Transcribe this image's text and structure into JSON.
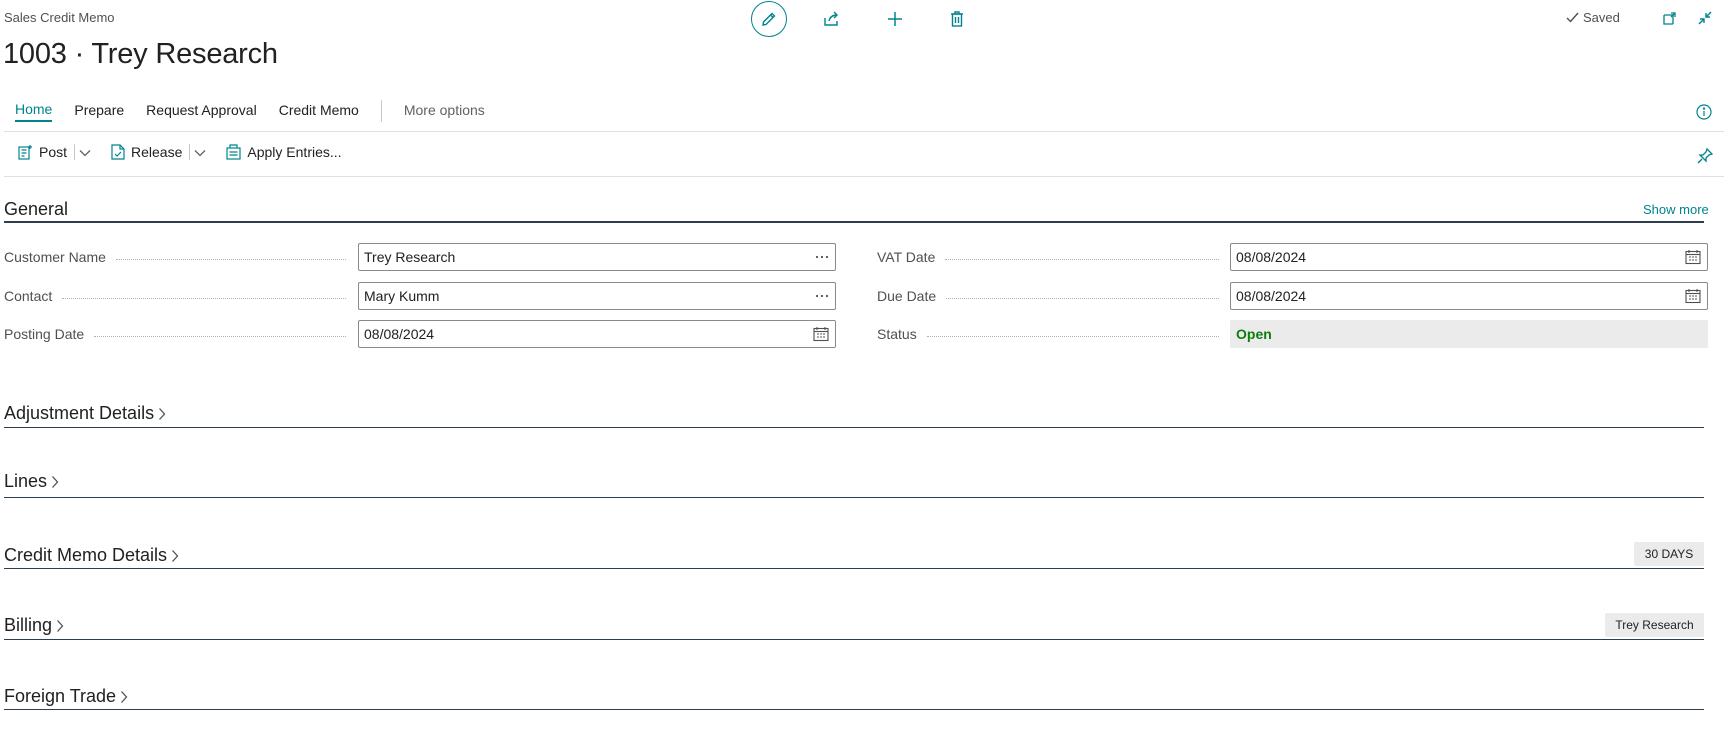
{
  "header": {
    "caption": "Sales Credit Memo",
    "title": "1003 · Trey Research",
    "saved_label": "Saved"
  },
  "tabs": [
    {
      "label": "Home"
    },
    {
      "label": "Prepare"
    },
    {
      "label": "Request Approval"
    },
    {
      "label": "Credit Memo"
    },
    {
      "label": "More options"
    }
  ],
  "actions": {
    "post": "Post",
    "release": "Release",
    "apply_entries": "Apply Entries..."
  },
  "general": {
    "title": "General",
    "show_more": "Show more",
    "fields": {
      "customer_name": {
        "label": "Customer Name",
        "value": "Trey Research"
      },
      "contact": {
        "label": "Contact",
        "value": "Mary Kumm"
      },
      "posting_date": {
        "label": "Posting Date",
        "value": "08/08/2024"
      },
      "vat_date": {
        "label": "VAT Date",
        "value": "08/08/2024"
      },
      "due_date": {
        "label": "Due Date",
        "value": "08/08/2024"
      },
      "status": {
        "label": "Status",
        "value": "Open"
      }
    }
  },
  "sections": {
    "adjustment_details": "Adjustment Details",
    "lines": "Lines",
    "credit_memo_details": "Credit Memo Details",
    "credit_memo_details_badge": "30 DAYS",
    "billing": "Billing",
    "billing_badge": "Trey Research",
    "foreign_trade": "Foreign Trade"
  },
  "colors": {
    "accent": "#00838f",
    "status_open": "#107c10",
    "section_rule": "#2c3e50"
  }
}
